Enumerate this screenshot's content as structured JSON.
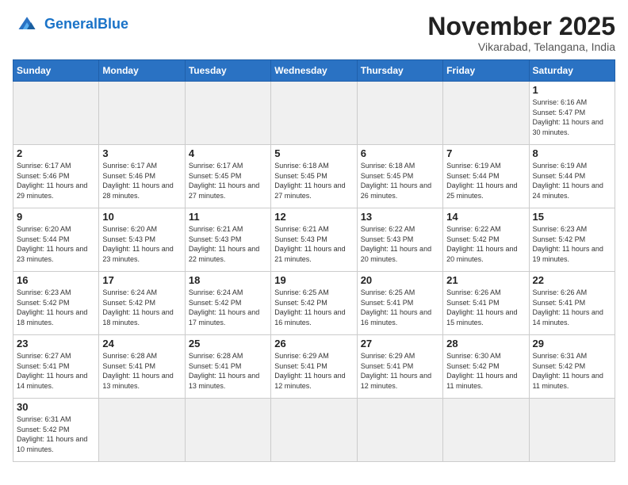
{
  "header": {
    "logo_general": "General",
    "logo_blue": "Blue",
    "month_title": "November 2025",
    "subtitle": "Vikarabad, Telangana, India"
  },
  "days_of_week": [
    "Sunday",
    "Monday",
    "Tuesday",
    "Wednesday",
    "Thursday",
    "Friday",
    "Saturday"
  ],
  "weeks": [
    [
      {
        "day": "",
        "empty": true
      },
      {
        "day": "",
        "empty": true
      },
      {
        "day": "",
        "empty": true
      },
      {
        "day": "",
        "empty": true
      },
      {
        "day": "",
        "empty": true
      },
      {
        "day": "",
        "empty": true
      },
      {
        "day": "1",
        "sunrise": "6:16 AM",
        "sunset": "5:47 PM",
        "daylight": "11 hours and 30 minutes."
      }
    ],
    [
      {
        "day": "2",
        "sunrise": "6:17 AM",
        "sunset": "5:46 PM",
        "daylight": "11 hours and 29 minutes."
      },
      {
        "day": "3",
        "sunrise": "6:17 AM",
        "sunset": "5:46 PM",
        "daylight": "11 hours and 28 minutes."
      },
      {
        "day": "4",
        "sunrise": "6:17 AM",
        "sunset": "5:45 PM",
        "daylight": "11 hours and 27 minutes."
      },
      {
        "day": "5",
        "sunrise": "6:18 AM",
        "sunset": "5:45 PM",
        "daylight": "11 hours and 27 minutes."
      },
      {
        "day": "6",
        "sunrise": "6:18 AM",
        "sunset": "5:45 PM",
        "daylight": "11 hours and 26 minutes."
      },
      {
        "day": "7",
        "sunrise": "6:19 AM",
        "sunset": "5:44 PM",
        "daylight": "11 hours and 25 minutes."
      },
      {
        "day": "8",
        "sunrise": "6:19 AM",
        "sunset": "5:44 PM",
        "daylight": "11 hours and 24 minutes."
      }
    ],
    [
      {
        "day": "9",
        "sunrise": "6:20 AM",
        "sunset": "5:44 PM",
        "daylight": "11 hours and 23 minutes."
      },
      {
        "day": "10",
        "sunrise": "6:20 AM",
        "sunset": "5:43 PM",
        "daylight": "11 hours and 23 minutes."
      },
      {
        "day": "11",
        "sunrise": "6:21 AM",
        "sunset": "5:43 PM",
        "daylight": "11 hours and 22 minutes."
      },
      {
        "day": "12",
        "sunrise": "6:21 AM",
        "sunset": "5:43 PM",
        "daylight": "11 hours and 21 minutes."
      },
      {
        "day": "13",
        "sunrise": "6:22 AM",
        "sunset": "5:43 PM",
        "daylight": "11 hours and 20 minutes."
      },
      {
        "day": "14",
        "sunrise": "6:22 AM",
        "sunset": "5:42 PM",
        "daylight": "11 hours and 20 minutes."
      },
      {
        "day": "15",
        "sunrise": "6:23 AM",
        "sunset": "5:42 PM",
        "daylight": "11 hours and 19 minutes."
      }
    ],
    [
      {
        "day": "16",
        "sunrise": "6:23 AM",
        "sunset": "5:42 PM",
        "daylight": "11 hours and 18 minutes."
      },
      {
        "day": "17",
        "sunrise": "6:24 AM",
        "sunset": "5:42 PM",
        "daylight": "11 hours and 18 minutes."
      },
      {
        "day": "18",
        "sunrise": "6:24 AM",
        "sunset": "5:42 PM",
        "daylight": "11 hours and 17 minutes."
      },
      {
        "day": "19",
        "sunrise": "6:25 AM",
        "sunset": "5:42 PM",
        "daylight": "11 hours and 16 minutes."
      },
      {
        "day": "20",
        "sunrise": "6:25 AM",
        "sunset": "5:41 PM",
        "daylight": "11 hours and 16 minutes."
      },
      {
        "day": "21",
        "sunrise": "6:26 AM",
        "sunset": "5:41 PM",
        "daylight": "11 hours and 15 minutes."
      },
      {
        "day": "22",
        "sunrise": "6:26 AM",
        "sunset": "5:41 PM",
        "daylight": "11 hours and 14 minutes."
      }
    ],
    [
      {
        "day": "23",
        "sunrise": "6:27 AM",
        "sunset": "5:41 PM",
        "daylight": "11 hours and 14 minutes."
      },
      {
        "day": "24",
        "sunrise": "6:28 AM",
        "sunset": "5:41 PM",
        "daylight": "11 hours and 13 minutes."
      },
      {
        "day": "25",
        "sunrise": "6:28 AM",
        "sunset": "5:41 PM",
        "daylight": "11 hours and 13 minutes."
      },
      {
        "day": "26",
        "sunrise": "6:29 AM",
        "sunset": "5:41 PM",
        "daylight": "11 hours and 12 minutes."
      },
      {
        "day": "27",
        "sunrise": "6:29 AM",
        "sunset": "5:41 PM",
        "daylight": "11 hours and 12 minutes."
      },
      {
        "day": "28",
        "sunrise": "6:30 AM",
        "sunset": "5:42 PM",
        "daylight": "11 hours and 11 minutes."
      },
      {
        "day": "29",
        "sunrise": "6:31 AM",
        "sunset": "5:42 PM",
        "daylight": "11 hours and 11 minutes."
      }
    ],
    [
      {
        "day": "30",
        "sunrise": "6:31 AM",
        "sunset": "5:42 PM",
        "daylight": "11 hours and 10 minutes."
      },
      {
        "day": "",
        "empty": true
      },
      {
        "day": "",
        "empty": true
      },
      {
        "day": "",
        "empty": true
      },
      {
        "day": "",
        "empty": true
      },
      {
        "day": "",
        "empty": true
      },
      {
        "day": "",
        "empty": true
      }
    ]
  ]
}
